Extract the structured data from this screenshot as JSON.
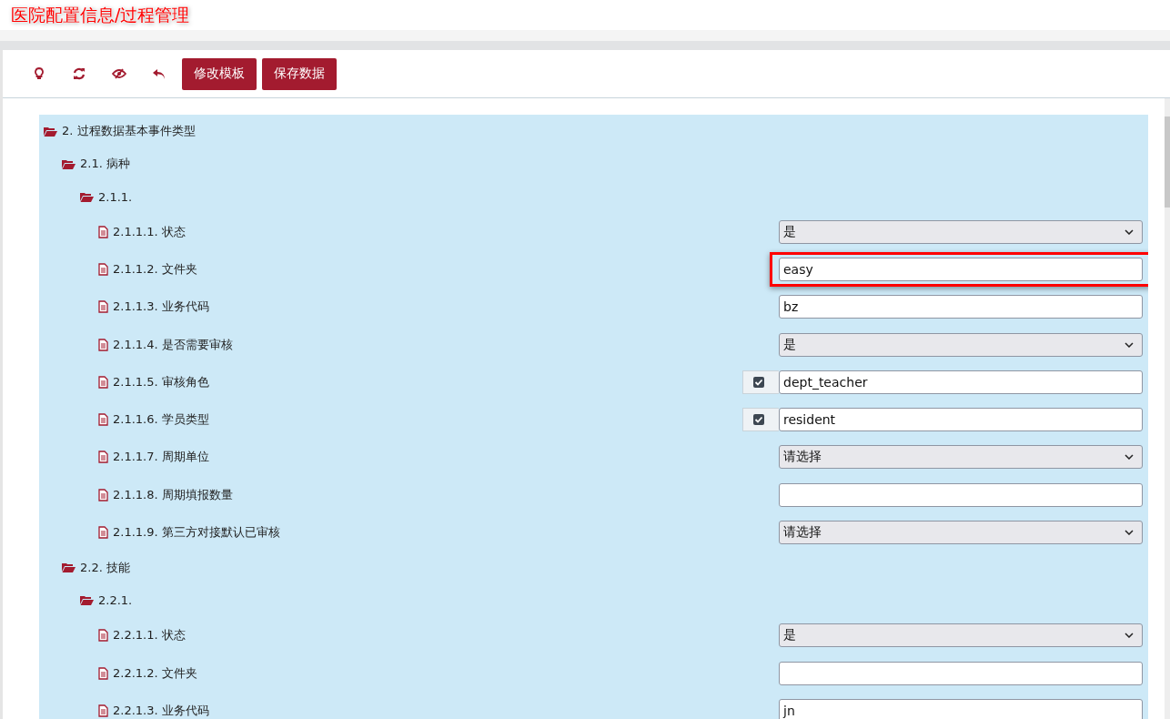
{
  "page_title": "医院配置信息/过程管理",
  "toolbar": {
    "icon_buttons": [
      {
        "kind": "bulb"
      },
      {
        "kind": "refresh"
      },
      {
        "kind": "hide"
      },
      {
        "kind": "undo"
      }
    ],
    "buttons": [
      "修改模板",
      "保存数据"
    ]
  },
  "tree": [
    {
      "label": "2. 过程数据基本事件类型",
      "expanded": true,
      "children": [
        {
          "label": "2.1. 病种",
          "expanded": true,
          "children": [
            {
              "label": "2.1.1.",
              "expanded": true,
              "children": [
                {
                  "label": "2.1.1.1. 状态",
                  "kind": "select",
                  "value": "是",
                  "highlighted": false
                },
                {
                  "label": "2.1.1.2. 文件夹",
                  "kind": "input",
                  "value": "easy",
                  "highlighted": true
                },
                {
                  "label": "2.1.1.3. 业务代码",
                  "kind": "input",
                  "value": "bz",
                  "highlighted": false
                },
                {
                  "label": "2.1.1.4. 是否需要审核",
                  "kind": "select",
                  "value": "是",
                  "highlighted": false
                },
                {
                  "label": "2.1.1.5. 审核角色",
                  "kind": "check-input",
                  "checked": true,
                  "value": "dept_teacher",
                  "highlighted": false
                },
                {
                  "label": "2.1.1.6. 学员类型",
                  "kind": "check-input",
                  "checked": true,
                  "value": "resident",
                  "highlighted": false
                },
                {
                  "label": "2.1.1.7. 周期单位",
                  "kind": "select",
                  "value": "请选择",
                  "highlighted": false
                },
                {
                  "label": "2.1.1.8. 周期填报数量",
                  "kind": "input",
                  "highlighted": false
                },
                {
                  "label": "2.1.1.9. 第三方对接默认已审核",
                  "kind": "select",
                  "value": "请选择",
                  "highlighted": false
                }
              ]
            }
          ]
        },
        {
          "label": "2.2. 技能",
          "expanded": true,
          "children": [
            {
              "label": "2.2.1.",
              "expanded": true,
              "children": [
                {
                  "label": "2.2.1.1. 状态",
                  "kind": "select",
                  "value": "是",
                  "highlighted": false
                },
                {
                  "label": "2.2.1.2. 文件夹",
                  "kind": "input",
                  "highlighted": false
                },
                {
                  "label": "2.2.1.3. 业务代码",
                  "kind": "input",
                  "value": "jn",
                  "highlighted": false
                }
              ]
            }
          ]
        }
      ]
    }
  ]
}
